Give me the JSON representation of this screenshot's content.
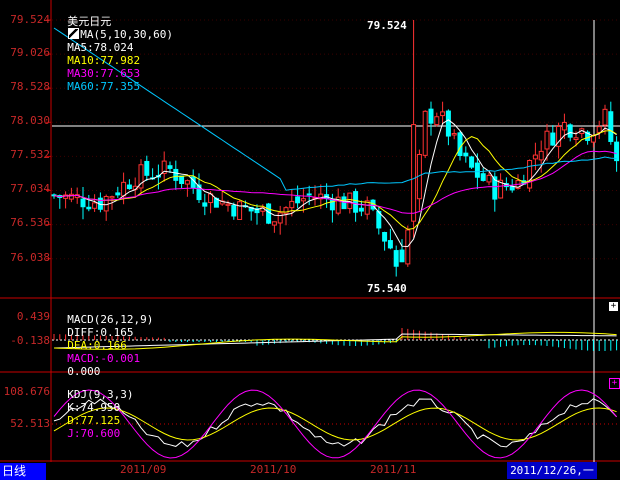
{
  "header": {
    "symbol": "美元日元",
    "ma_group": "MA(5,10,30,60)",
    "ma5": "MA5:78.024",
    "ma10": "MA10:77.982",
    "ma30": "MA30:77.653",
    "ma60": "MA60:77.355"
  },
  "price_axis": [
    "79.524",
    "79.026",
    "78.528",
    "78.030",
    "77.532",
    "77.034",
    "76.536",
    "76.038"
  ],
  "annotations": {
    "high": "79.524",
    "low": "75.540"
  },
  "macd": {
    "title": "MACD(26,12,9)",
    "diff": "DIFF:0.165",
    "dea": "DEA:0.166",
    "macd": "MACD:-0.001",
    "extra": "0.000",
    "axis": [
      "0.439",
      "-0.138"
    ]
  },
  "kdj": {
    "title": "KDJ(9,3,3)",
    "k": "K:74.950",
    "d": "D:77.125",
    "j": "J:70.600",
    "axis": [
      "108.676",
      "52.513"
    ]
  },
  "x_axis": [
    "2011/09",
    "2011/10",
    "2011/11",
    "2011/12/26,一"
  ],
  "period_label": "日线",
  "colors": {
    "up": "#ff3232",
    "down": "#00ffff",
    "grid": "#c80000",
    "ma5": "#ffffff",
    "ma10": "#ffff00",
    "ma30": "#ff00ff",
    "ma60": "#00c8ff"
  },
  "icons": [
    "chart-type-icon",
    "plus-icon"
  ]
}
